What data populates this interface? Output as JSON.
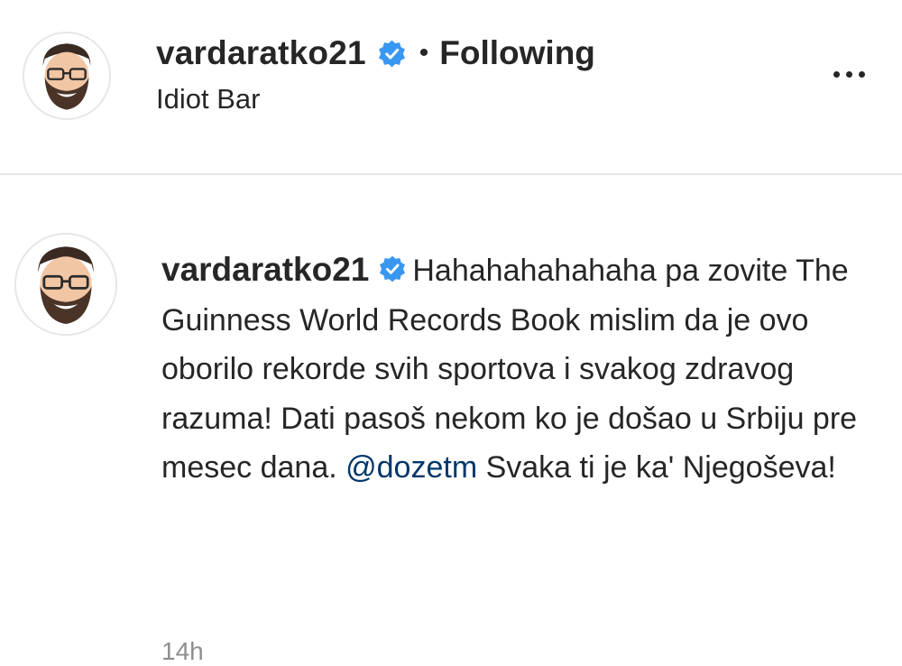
{
  "post_header": {
    "username": "vardaratko21",
    "separator": "•",
    "follow_status": "Following",
    "location": "Idiot Bar"
  },
  "comment": {
    "username": "vardaratko21",
    "text_before_mention": "Hahahahahahaha pa zovite The Guinness World Records Book mislim da je ovo oborilo rekorde svih sportova i svakog zdravog razuma! Dati pasoš nekom ko je došao u Srbiju pre mesec dana. ",
    "mention": "@dozetm",
    "text_after_mention": " Svaka ti je ka' Njegoševa!",
    "timestamp": "14h"
  },
  "colors": {
    "verified_badge": "#3897f0",
    "mention": "#00376b",
    "divider": "#e6e6e6"
  },
  "icons": {
    "verified": "verified-badge-icon",
    "more": "more-options-icon"
  }
}
